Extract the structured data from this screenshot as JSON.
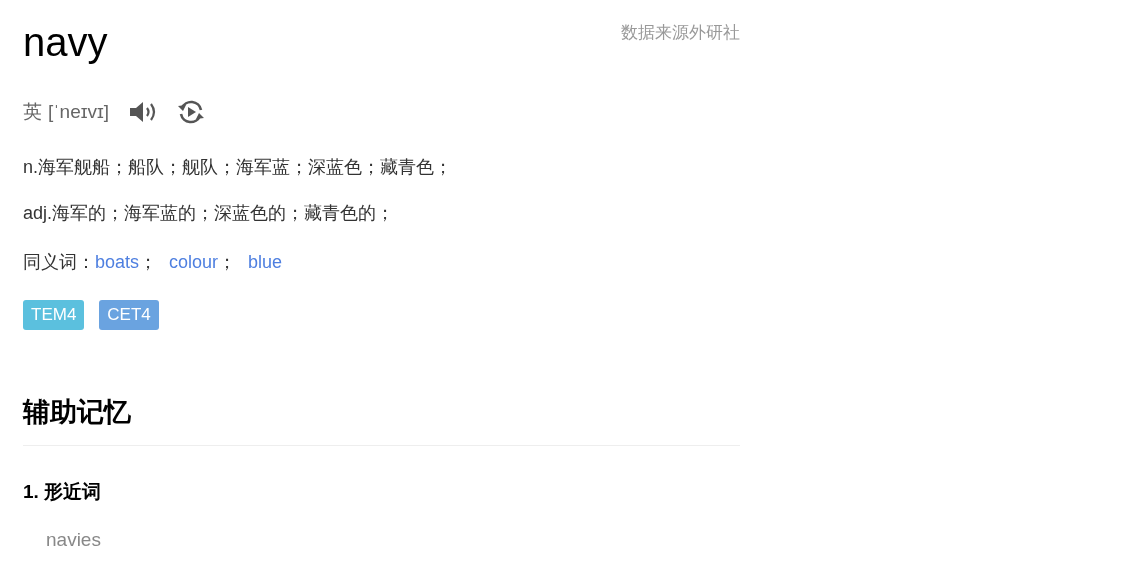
{
  "word": "navy",
  "source": "数据来源外研社",
  "pronunciation": {
    "label": "英",
    "phonetic": "[ˈneɪvɪ]"
  },
  "definitions": [
    "n.海军舰船；船队；舰队；海军蓝；深蓝色；藏青色；",
    "adj.海军的；海军蓝的；深蓝色的；藏青色的；"
  ],
  "synonyms": {
    "label": "同义词：",
    "separator": "；",
    "words": [
      "boats",
      "colour",
      "blue"
    ]
  },
  "tags": [
    {
      "label": "TEM4",
      "color": "#5bc0de"
    },
    {
      "label": "CET4",
      "color": "#6aa3e0"
    }
  ],
  "memory": {
    "title": "辅助记忆",
    "sections": [
      {
        "title": "1. 形近词",
        "items": [
          "navies"
        ]
      }
    ]
  }
}
